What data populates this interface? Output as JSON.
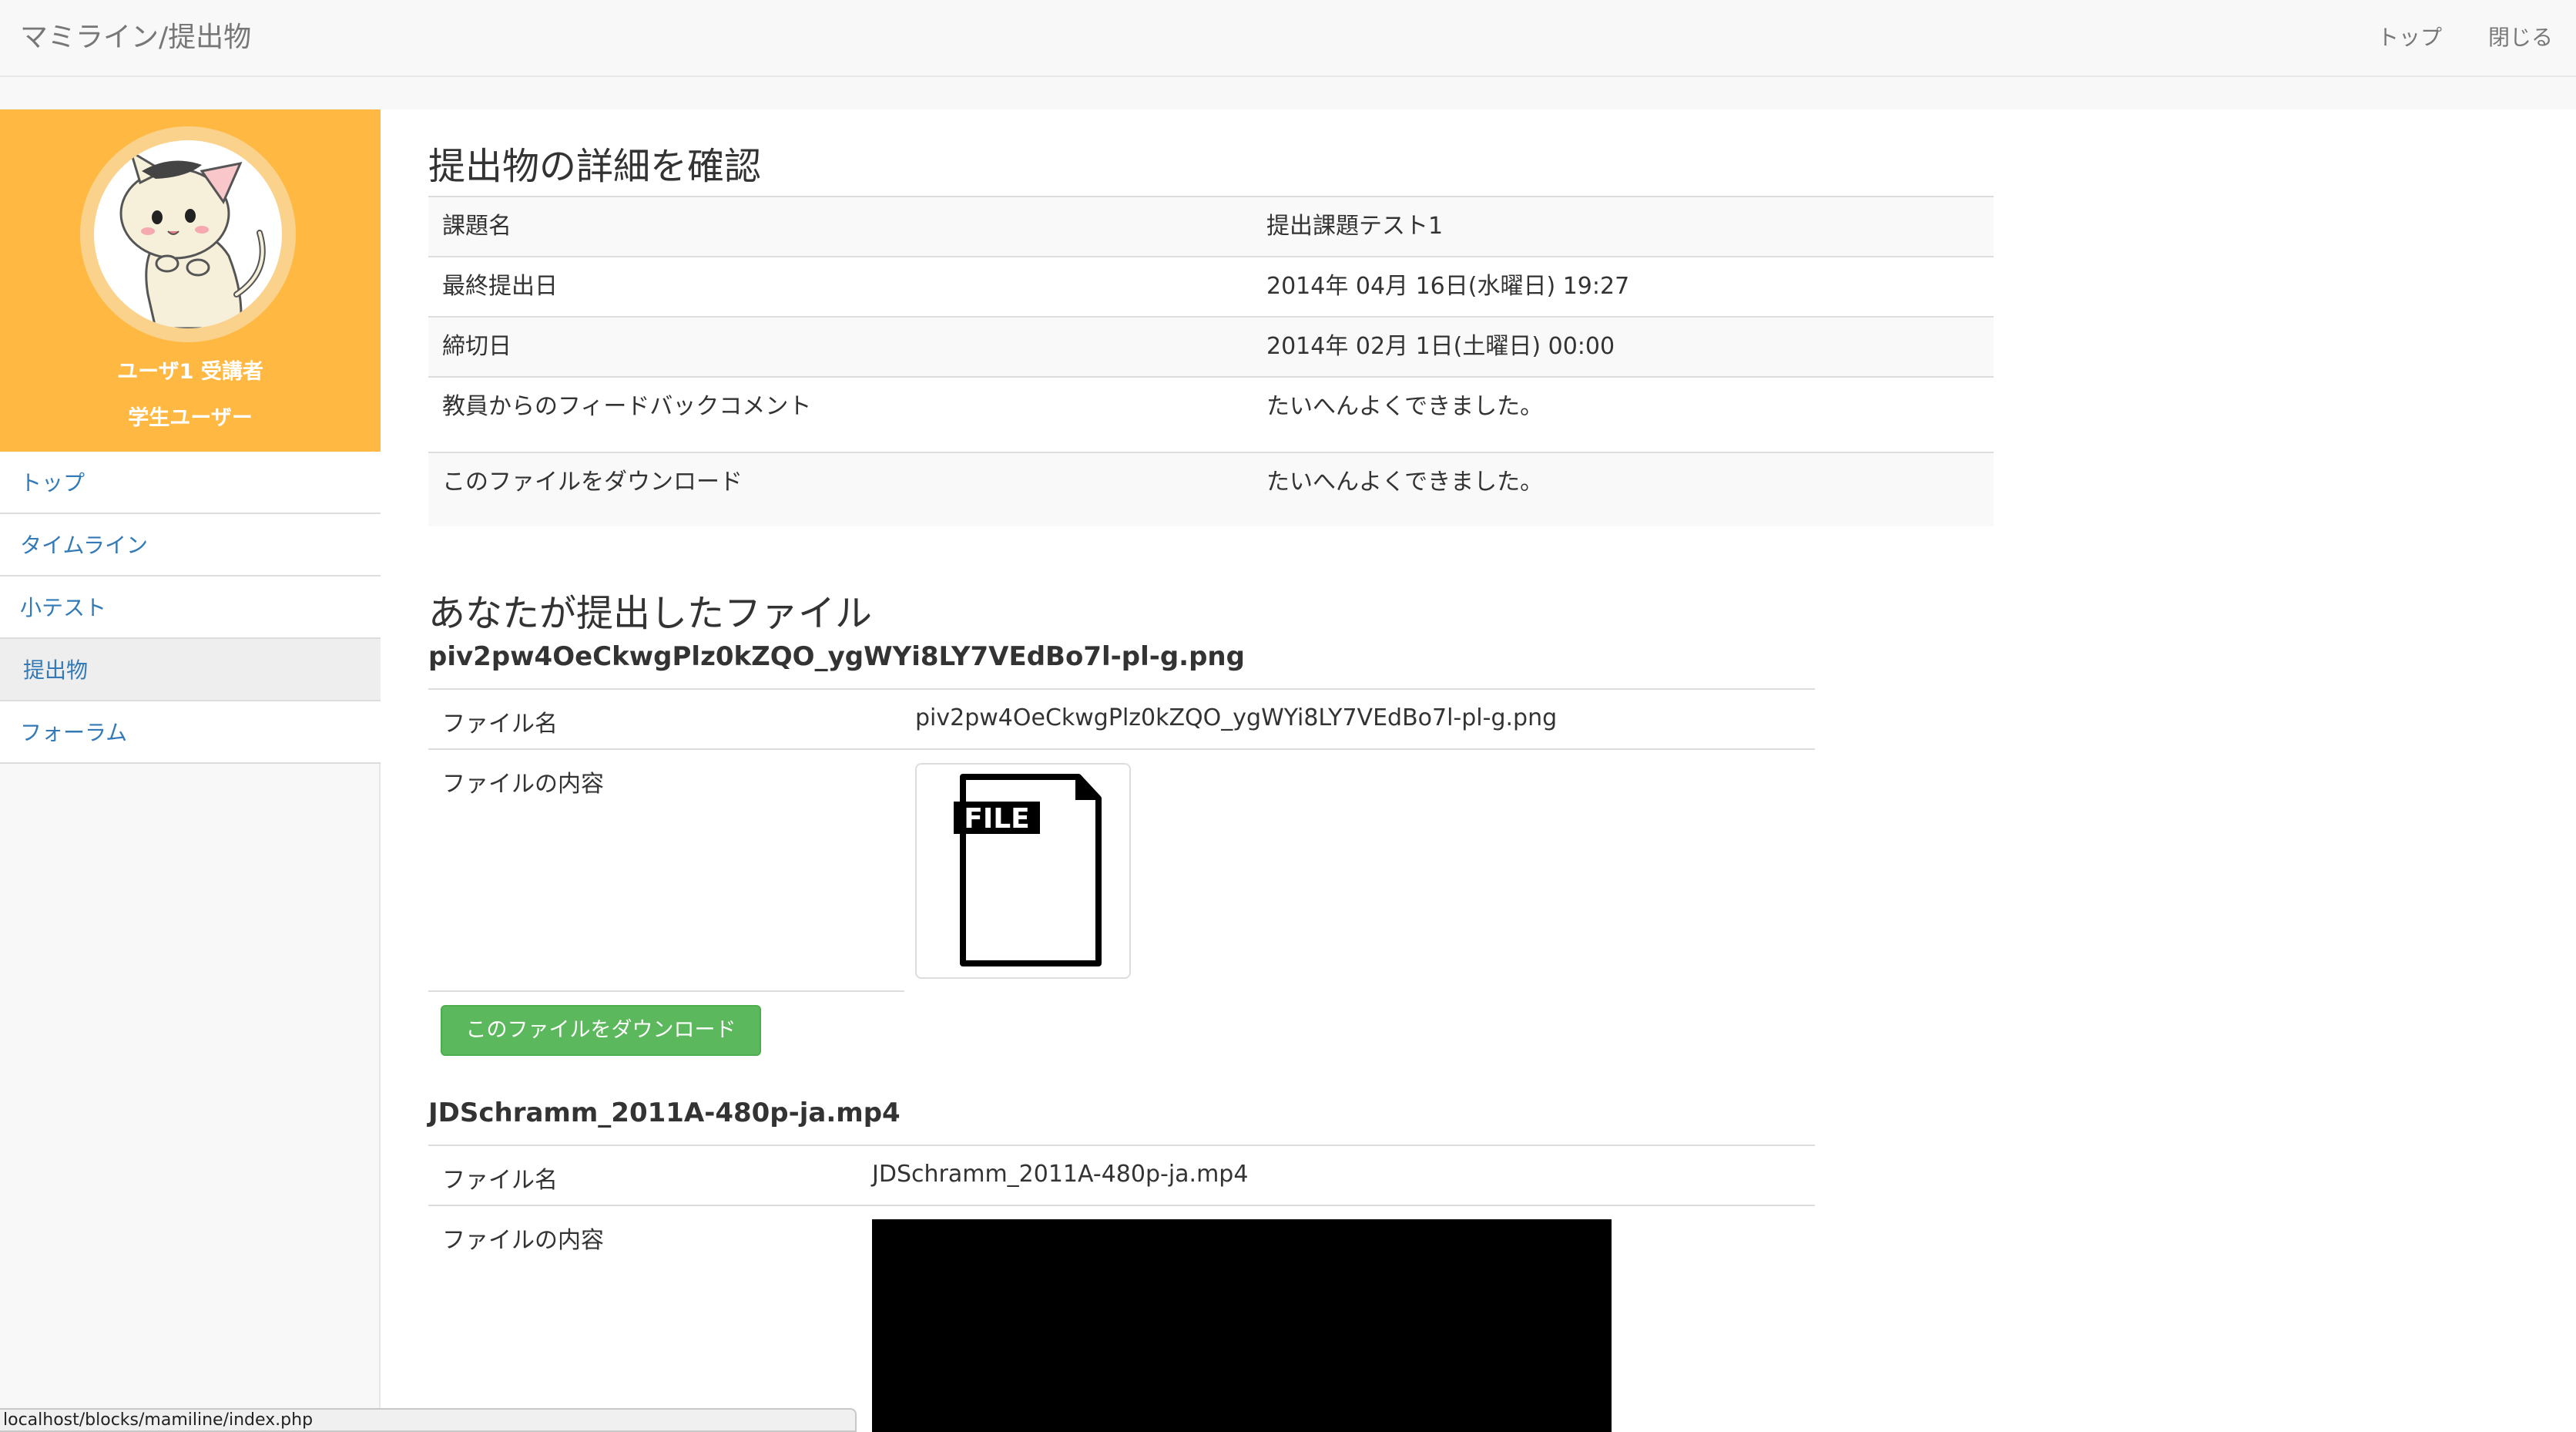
{
  "navbar": {
    "brand": "マミライン/提出物",
    "links": [
      "トップ",
      "閉じる"
    ]
  },
  "sidebar": {
    "user_name": "ユーザ1 受講者",
    "user_role": "学生ユーザー",
    "items": [
      {
        "label": "トップ",
        "active": false
      },
      {
        "label": "タイムライン",
        "active": false
      },
      {
        "label": "小テスト",
        "active": false
      },
      {
        "label": "提出物",
        "active": true
      },
      {
        "label": "フォーラム",
        "active": false
      }
    ]
  },
  "details": {
    "title": "提出物の詳細を確認",
    "rows": [
      {
        "label": "課題名",
        "value": "提出課題テスト1"
      },
      {
        "label": "最終提出日",
        "value": "2014年 04月 16日(水曜日) 19:27"
      },
      {
        "label": "締切日",
        "value": "2014年 02月 1日(土曜日) 00:00"
      },
      {
        "label": "教員からのフィードバックコメント",
        "value": "たいへんよくできました。"
      },
      {
        "label": "このファイルをダウンロード",
        "value": "たいへんよくできました。"
      }
    ]
  },
  "files": {
    "title": "あなたが提出したファイル",
    "items": [
      {
        "heading": "piv2pw4OeCkwgPlz0kZQO_ygWYi8LY7VEdBo7l-pl-g.png",
        "name_label": "ファイル名",
        "name_value": "piv2pw4OeCkwgPlz0kZQO_ygWYi8LY7VEdBo7l-pl-g.png",
        "content_label": "ファイルの内容",
        "file_icon_text": "FILE",
        "download_label": "このファイルをダウンロード"
      },
      {
        "heading": "JDSchramm_2011A-480p-ja.mp4",
        "name_label": "ファイル名",
        "name_value": "JDSchramm_2011A-480p-ja.mp4",
        "content_label": "ファイルの内容"
      }
    ]
  },
  "status_bar": {
    "url": "localhost/blocks/mamiline/index.php"
  }
}
